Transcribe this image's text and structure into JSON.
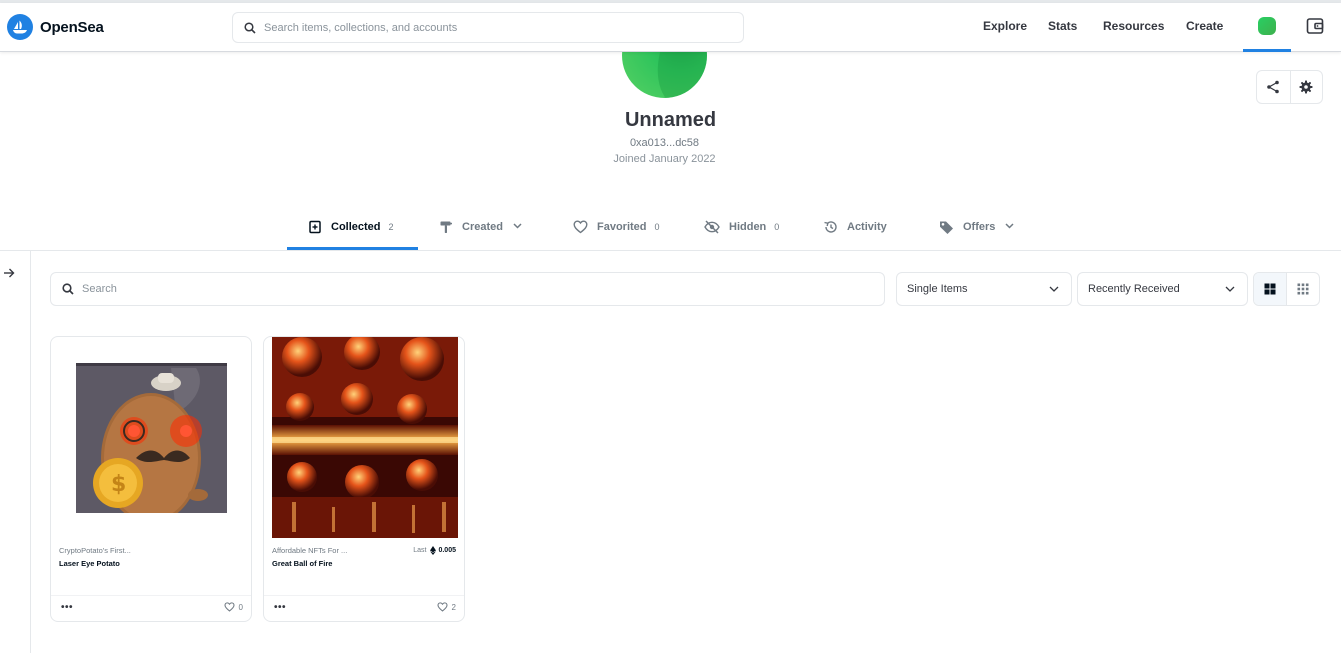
{
  "navbar": {
    "brand": "OpenSea",
    "search_placeholder": "Search items, collections, and accounts",
    "links": [
      "Explore",
      "Stats",
      "Resources",
      "Create"
    ]
  },
  "profile": {
    "name": "Unnamed",
    "address": "0xa013...dc58",
    "joined": "Joined January 2022"
  },
  "tabs": [
    {
      "label": "Collected",
      "count": "2",
      "icon": "collected-icon"
    },
    {
      "label": "Created",
      "icon": "brush-icon",
      "dropdown": true
    },
    {
      "label": "Favorited",
      "count": "0",
      "icon": "heart-icon"
    },
    {
      "label": "Hidden",
      "count": "0",
      "icon": "eye-off-icon"
    },
    {
      "label": "Activity",
      "icon": "history-icon"
    },
    {
      "label": "Offers",
      "icon": "tag-icon",
      "dropdown": true
    }
  ],
  "filters": {
    "search_placeholder": "Search",
    "item_type": "Single Items",
    "sort": "Recently Received"
  },
  "items": [
    {
      "collection": "CryptoPotato's First...",
      "name": "Laser Eye Potato",
      "last_label": "",
      "last_price": "",
      "likes": "0"
    },
    {
      "collection": "Affordable NFTs For ...",
      "name": "Great Ball of Fire",
      "last_label": "Last",
      "last_price": "0.005",
      "likes": "2"
    }
  ],
  "colors": {
    "accent": "#2081e2",
    "text": "#353840",
    "muted": "#707a83",
    "avatar": "#2fc45c"
  }
}
